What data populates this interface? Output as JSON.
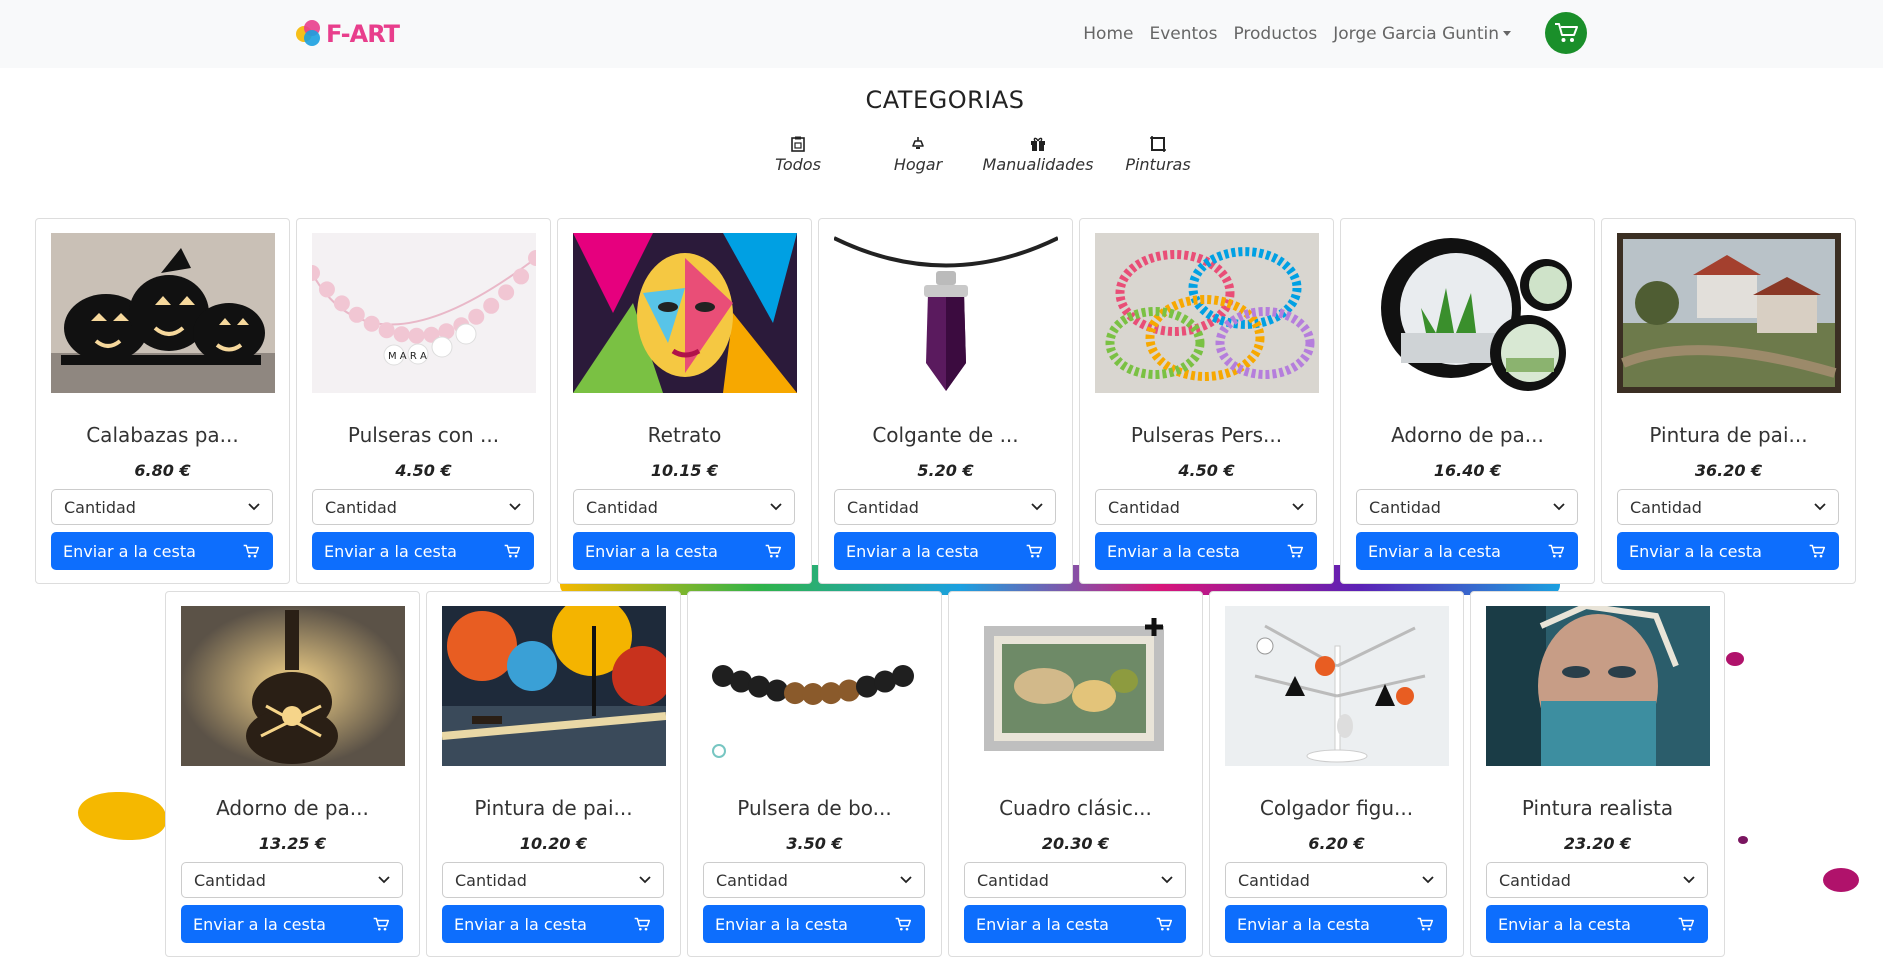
{
  "brand": {
    "name": "F-ART"
  },
  "nav": {
    "links": [
      "Home",
      "Eventos",
      "Productos"
    ],
    "user": "Jorge Garcia Guntin"
  },
  "categories": {
    "title": "CATEGORIAS",
    "items": [
      {
        "label": "Todos",
        "icon": "clipboard-icon"
      },
      {
        "label": "Hogar",
        "icon": "lamp-icon"
      },
      {
        "label": "Manualidades",
        "icon": "gift-icon"
      },
      {
        "label": "Pinturas",
        "icon": "frame-icon"
      }
    ]
  },
  "products": {
    "qty_label": "Cantidad",
    "add_label": "Enviar a la cesta",
    "row1": [
      {
        "name": "Calabazas pa...",
        "price": "6.80 €"
      },
      {
        "name": "Pulseras con ...",
        "price": "4.50 €"
      },
      {
        "name": "Retrato",
        "price": "10.15 €"
      },
      {
        "name": "Colgante de ...",
        "price": "5.20 €"
      },
      {
        "name": "Pulseras Pers...",
        "price": "4.50 €"
      },
      {
        "name": "Adorno de pa...",
        "price": "16.40 €"
      },
      {
        "name": "Pintura de pai...",
        "price": "36.20 €"
      }
    ],
    "row2": [
      {
        "name": "Adorno de pa...",
        "price": "13.25 €"
      },
      {
        "name": "Pintura de pai...",
        "price": "10.20 €"
      },
      {
        "name": "Pulsera de bo...",
        "price": "3.50 €"
      },
      {
        "name": "Cuadro clásic...",
        "price": "20.30 €"
      },
      {
        "name": "Colgador figu...",
        "price": "6.20 €"
      },
      {
        "name": "Pintura realista",
        "price": "23.20 €"
      }
    ]
  },
  "colors": {
    "accent": "#0d6efd",
    "cart": "#1a8f2a",
    "brand": "#e83e8c"
  }
}
